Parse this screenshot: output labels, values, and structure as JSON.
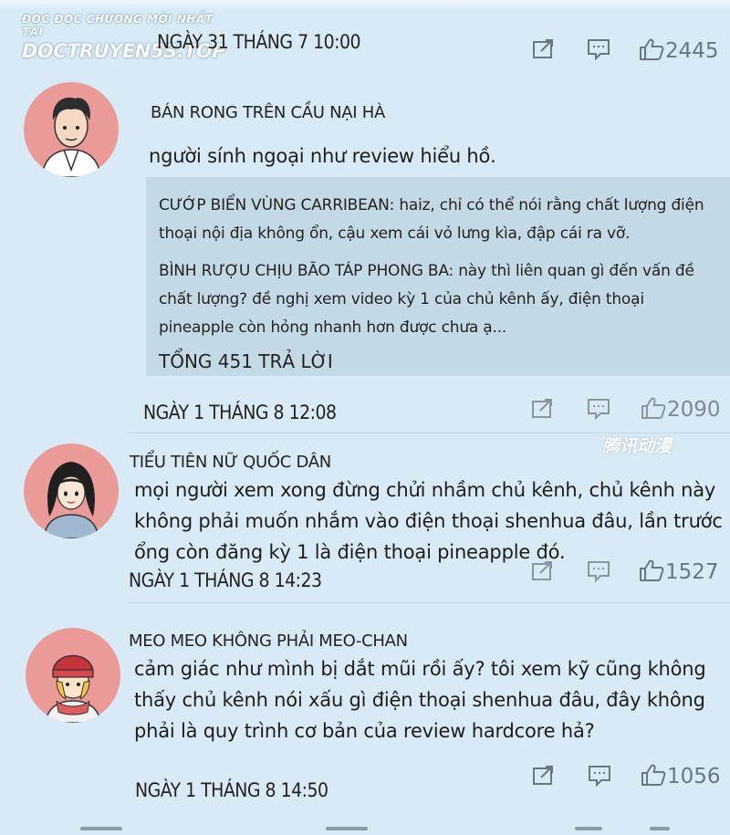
{
  "watermark": {
    "line1": "ĐỌC ĐỌC CHƯƠNG MỚI NHẤT TẠI",
    "line2": "DOCTRUYEN5S.TOP"
  },
  "top_meta": {
    "date": "NGÀY 31 THÁNG 7 10:00",
    "likes": "2445"
  },
  "comments": [
    {
      "username": "BÁN RONG TRÊN CẦU NẠI HÀ",
      "text": "người sính ngoại như review hiểu hồ.",
      "replies": [
        "CƯỚP BIỂN VÙNG CARRIBEAN: haiz, chỉ có thể nói rằng chất lượng điện thoại nội địa không ổn, cậu xem cái vỏ lưng kìa, đập cái ra vỡ.",
        "BÌNH RƯỢU CHỊU BÃO TÁP PHONG BA: này thì liên quan gì đến vấn đề chất lượng? đề nghị xem video kỳ 1 của chủ kênh ấy, điện thoại pineapple còn hỏng nhanh hơn được chưa ạ..."
      ],
      "total_replies": "TỔNG 451 TRẢ LỜI",
      "date": "NGÀY 1 THÁNG 8 12:08",
      "likes": "2090"
    },
    {
      "username": "TIỂU TIÊN NỮ QUỐC DÂN",
      "text": "mọi người xem xong đừng chửi nhầm chủ kênh, chủ kênh này không phải muốn nhắm vào điện thoại shenhua đâu, lần trước ổng còn đăng kỳ 1 là điện thoại pineapple đó.",
      "date": "NGÀY 1 THÁNG 8 14:23",
      "likes": "1527"
    },
    {
      "username": "MEO MEO KHÔNG PHẢI MEO-CHAN",
      "text": "cảm giác như mình bị dắt mũi rồi ấy? tôi xem kỹ cũng không thấy chủ kênh nói xấu gì điện thoại shenhua đâu, đây không phải là quy trình cơ bản của review hardcore hả?",
      "date": "NGÀY 1 THÁNG 8 14:50",
      "likes": "1056"
    }
  ],
  "faint_logo": "腾讯动漫",
  "icons": {
    "share": "share-icon",
    "comment": "comment-icon",
    "like": "thumbs-up-icon"
  },
  "colors": {
    "background": "#d7eaf5",
    "reply_box": "#c4d9e6",
    "avatar_bg": "#ea9b98",
    "icon_gray": "#6a7680"
  }
}
